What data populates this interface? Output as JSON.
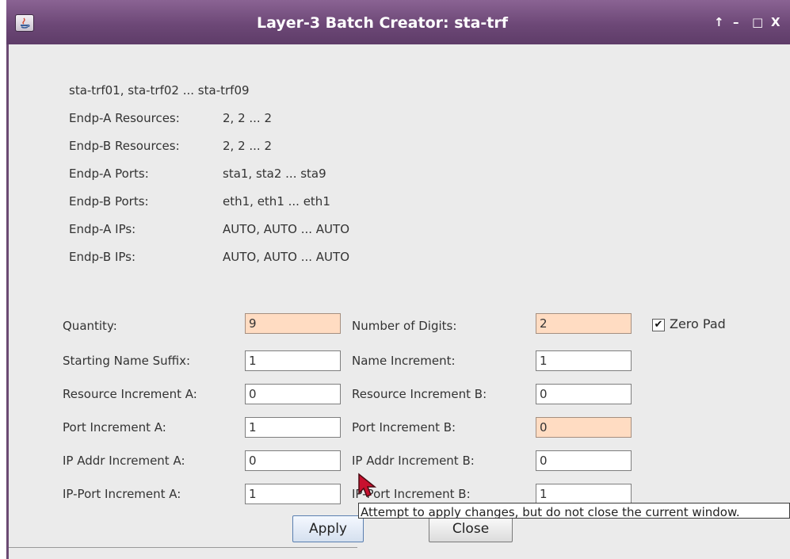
{
  "window": {
    "title": "Layer-3 Batch Creator: sta-trf"
  },
  "titlebar_controls": {
    "up": "↑",
    "minimize": "–",
    "maximize": "□",
    "close": "X"
  },
  "summary": {
    "names": "sta-trf01, sta-trf02 ... sta-trf09",
    "rows": [
      {
        "label": "Endp-A Resources:",
        "value": "2, 2 ... 2"
      },
      {
        "label": "Endp-B Resources:",
        "value": "2, 2 ... 2"
      },
      {
        "label": "Endp-A Ports:",
        "value": "sta1, sta2 ... sta9"
      },
      {
        "label": "Endp-B Ports:",
        "value": "eth1, eth1 ... eth1"
      },
      {
        "label": "Endp-A IPs:",
        "value": "AUTO, AUTO ... AUTO"
      },
      {
        "label": "Endp-B IPs:",
        "value": "AUTO, AUTO ... AUTO"
      }
    ]
  },
  "form": {
    "left": [
      {
        "label": "Quantity:",
        "value": "9",
        "highlight": true
      },
      {
        "label": "Starting Name Suffix:",
        "value": "1",
        "highlight": false
      },
      {
        "label": "Resource Increment A:",
        "value": "0",
        "highlight": false
      },
      {
        "label": "Port Increment A:",
        "value": "1",
        "highlight": false
      },
      {
        "label": "IP Addr Increment A:",
        "value": "0",
        "highlight": false
      },
      {
        "label": "IP-Port Increment A:",
        "value": "1",
        "highlight": false
      }
    ],
    "right": [
      {
        "label": "Number of Digits:",
        "value": "2",
        "highlight": true
      },
      {
        "label": "Name Increment:",
        "value": "1",
        "highlight": false
      },
      {
        "label": "Resource Increment B:",
        "value": "0",
        "highlight": false
      },
      {
        "label": "Port Increment B:",
        "value": "0",
        "highlight": true
      },
      {
        "label": "IP Addr Increment B:",
        "value": "0",
        "highlight": false
      },
      {
        "label": "IP-Port Increment B:",
        "value": "1",
        "highlight": false
      }
    ],
    "zero_pad": {
      "label": "Zero Pad",
      "checked": true,
      "mark": "✔"
    }
  },
  "buttons": {
    "apply": "Apply",
    "close": "Close"
  },
  "tooltip": "Attempt to apply changes, but do not close the current window."
}
